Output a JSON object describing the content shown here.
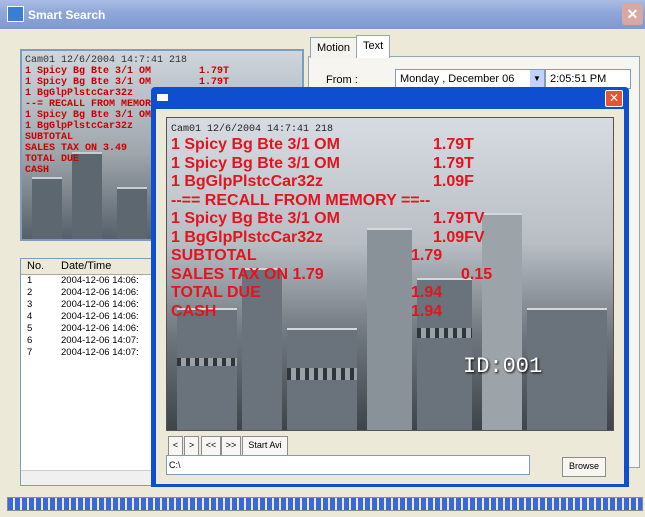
{
  "window": {
    "title": "Smart Search",
    "close_glyph": "✕"
  },
  "tabs": [
    "Motion",
    "Text"
  ],
  "from": {
    "label": "From :",
    "date_value": "Monday , December 06",
    "time_value": "2:05:51 PM"
  },
  "bg_overlay": {
    "stamp": "Cam01 12/6/2004 14:7:41 218",
    "lines": [
      "1 Spicy Bg Bte 3/1 OM        1.79T",
      "1 Spicy Bg Bte 3/1 OM        1.79T",
      "1 BgGlpPlstcCar32z",
      "--= RECALL FROM MEMORY",
      "1 Spicy Bg Bte 3/1 OM",
      "1 BgGlpPlstcCar32z",
      "SUBTOTAL",
      "SALES TAX ON 3.49",
      "TOTAL DUE",
      "CASH"
    ]
  },
  "list": {
    "columns": [
      "No.",
      "Date/Time"
    ],
    "rows": [
      [
        "1",
        "2004-12-06 14:06:"
      ],
      [
        "2",
        "2004-12-06 14:06:"
      ],
      [
        "3",
        "2004-12-06 14:06:"
      ],
      [
        "4",
        "2004-12-06 14:06:"
      ],
      [
        "5",
        "2004-12-06 14:06:"
      ],
      [
        "6",
        "2004-12-06 14:07:"
      ],
      [
        "7",
        "2004-12-06 14:07:"
      ]
    ]
  },
  "viewer": {
    "close_glyph": "✕",
    "stamp": "Cam01 12/6/2004 14:7:41 218",
    "receipt": [
      {
        "item": "1  Spicy Bg Bte 3/1 OM",
        "amount": "1.79T"
      },
      {
        "item": "1  Spicy Bg Bte 3/1 OM",
        "amount": "1.79T"
      },
      {
        "item": "1  BgGlpPlstcCar32z",
        "amount": "1.09F"
      },
      {
        "item": "--== RECALL FROM MEMORY ==--",
        "amount": ""
      },
      {
        "item": "1  Spicy Bg Bte 3/1 OM",
        "amount": "1.79TV"
      },
      {
        "item": "1  BgGlpPlstcCar32z",
        "amount": "1.09FV"
      },
      {
        "item": "SUBTOTAL",
        "amount": "1.79"
      },
      {
        "item": "SALES TAX ON 1.79",
        "amount": "0.15"
      },
      {
        "item": "TOTAL DUE",
        "amount": "1.94"
      },
      {
        "item": "CASH",
        "amount": "1.94"
      }
    ],
    "camera_id": "ID:001",
    "controls": [
      "<",
      ">",
      "<<",
      ">>",
      "Start Avi"
    ],
    "path_value": "C:\\",
    "browse_label": "Browse"
  },
  "colors": {
    "receipt_text": "#e3141f",
    "titlebar": "#0d4fd0",
    "progress": "#3a68d8"
  }
}
